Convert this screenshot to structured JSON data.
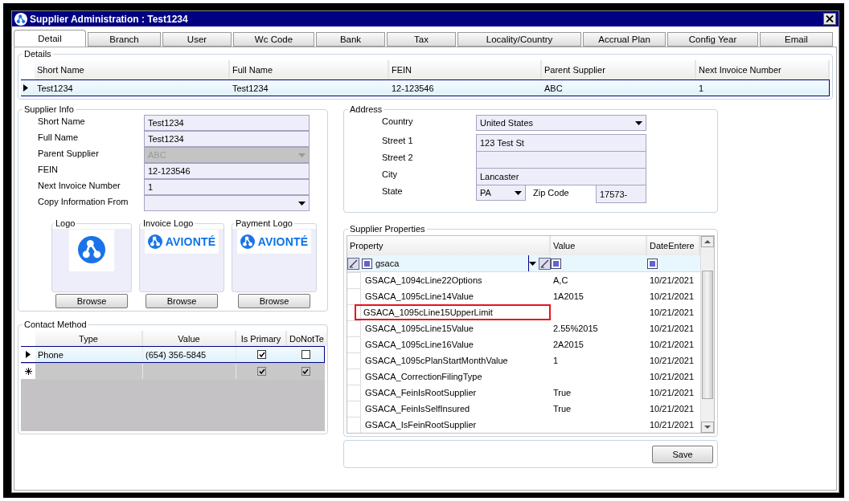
{
  "window": {
    "title": "Supplier Administration : Test1234"
  },
  "tabs": [
    {
      "label": "Detail",
      "selected": true
    },
    {
      "label": "Branch",
      "selected": false
    },
    {
      "label": "User",
      "selected": false
    },
    {
      "label": "Wc Code",
      "selected": false
    },
    {
      "label": "Bank",
      "selected": false
    },
    {
      "label": "Tax",
      "selected": false
    },
    {
      "label": "Locality/Country",
      "selected": false
    },
    {
      "label": "Accrual Plan",
      "selected": false
    },
    {
      "label": "Config Year",
      "selected": false
    },
    {
      "label": "Email",
      "selected": false
    }
  ],
  "details": {
    "title": "Details",
    "columns": [
      "Short Name",
      "Full Name",
      "FEIN",
      "Parent Supplier",
      "Next Invoice Number"
    ],
    "rows": [
      {
        "selected": true,
        "cells": [
          "Test1234",
          "Test1234",
          "12-123546",
          "ABC",
          "1"
        ]
      }
    ]
  },
  "supplier_info": {
    "title": "Supplier Info",
    "fields": [
      {
        "label": "Short Name",
        "value": "Test1234",
        "kind": "text",
        "disabled": false
      },
      {
        "label": "Full Name",
        "value": "Test1234",
        "kind": "text",
        "disabled": false
      },
      {
        "label": "Parent Supplier",
        "value": "ABC",
        "kind": "dropdown",
        "disabled": true
      },
      {
        "label": "FEIN",
        "value": "12-123546",
        "kind": "text",
        "disabled": false
      },
      {
        "label": "Next Invoice Number",
        "value": "1",
        "kind": "text",
        "disabled": false
      },
      {
        "label": "Copy Information From",
        "kind": "dropdown",
        "disabled": false
      }
    ],
    "logos": [
      {
        "title": "Logo",
        "kind": "mark",
        "button": "Browse"
      },
      {
        "title": "Invoice Logo",
        "kind": "wordmark",
        "text": "AVIONTÉ",
        "button": "Browse"
      },
      {
        "title": "Payment Logo",
        "kind": "wordmark",
        "text": "AVIONTÉ",
        "button": "Browse"
      }
    ]
  },
  "contact_method": {
    "title": "Contact Method",
    "columns": [
      "Type",
      "Value",
      "Is Primary",
      "DoNotTe"
    ],
    "rows": [
      {
        "kind": "data",
        "selected": true,
        "type": "Phone",
        "value": "(654) 356-5845",
        "is_primary": true,
        "do_not": false
      },
      {
        "kind": "new",
        "selected": false,
        "is_primary": true,
        "do_not": true
      }
    ]
  },
  "address": {
    "title": "Address",
    "fields": [
      {
        "label": "Country",
        "value": "United States",
        "kind": "dropdown"
      },
      {
        "label": "Street 1",
        "value": "123 Test St",
        "kind": "text"
      },
      {
        "label": "Street 2",
        "kind": "text"
      },
      {
        "label": "City",
        "value": "Lancaster",
        "kind": "text"
      }
    ],
    "state": {
      "label": "State",
      "value": "PA"
    },
    "zip": {
      "label": "Zip Code",
      "value": "17573-"
    }
  },
  "supplier_properties": {
    "title": "Supplier Properties",
    "columns": [
      "Property",
      "Value",
      "DateEntere"
    ],
    "filter": {
      "value": "gsaca"
    },
    "rows": [
      {
        "property": "GSACA_1094cLine22Options",
        "value": "A,C",
        "date": "10/21/2021",
        "highlighted": false
      },
      {
        "property": "GSACA_1095cLine14Value",
        "value": "1A2015",
        "date": "10/21/2021",
        "highlighted": false
      },
      {
        "property": "GSACA_1095cLine15UpperLimit",
        "date": "10/21/2021",
        "highlighted": true
      },
      {
        "property": "GSACA_1095cLine15Value",
        "value": "2.55%2015",
        "date": "10/21/2021",
        "highlighted": false
      },
      {
        "property": "GSACA_1095cLine16Value",
        "value": "2A2015",
        "date": "10/21/2021",
        "highlighted": false
      },
      {
        "property": "GSACA_1095cPlanStartMonthValue",
        "value": "1",
        "date": "10/21/2021",
        "highlighted": false
      },
      {
        "property": "GSACA_CorrectionFilingType",
        "date": "10/21/2021",
        "highlighted": false
      },
      {
        "property": "GSACA_FeinIsRootSupplier",
        "value": "True",
        "date": "10/21/2021",
        "highlighted": false
      },
      {
        "property": "GSACA_FeinIsSelfInsured",
        "value": "True",
        "date": "10/21/2021",
        "highlighted": false
      },
      {
        "property": "GSACA_IsFeinRootSupplier",
        "date": "10/21/2021",
        "highlighted": false
      }
    ]
  },
  "save_button": "Save"
}
